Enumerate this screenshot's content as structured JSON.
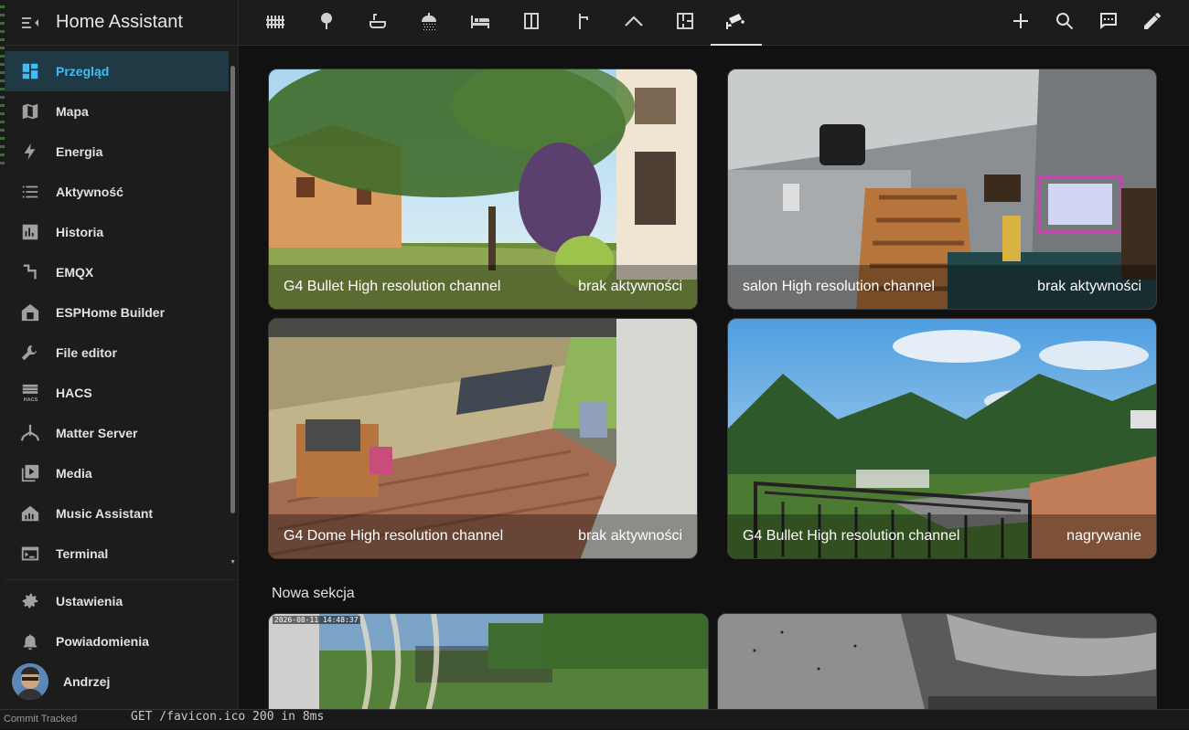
{
  "sidebar": {
    "title": "Home Assistant",
    "items": [
      {
        "label": "Przegląd",
        "icon": "dashboard-icon"
      },
      {
        "label": "Mapa",
        "icon": "map-icon"
      },
      {
        "label": "Energia",
        "icon": "lightning-icon"
      },
      {
        "label": "Aktywność",
        "icon": "list-icon"
      },
      {
        "label": "Historia",
        "icon": "chart-icon"
      },
      {
        "label": "EMQX",
        "icon": "network-icon"
      },
      {
        "label": "ESPHome Builder",
        "icon": "esphome-icon"
      },
      {
        "label": "File editor",
        "icon": "wrench-icon"
      },
      {
        "label": "HACS",
        "icon": "hacs-icon"
      },
      {
        "label": "Matter Server",
        "icon": "matter-icon"
      },
      {
        "label": "Media",
        "icon": "play-icon"
      },
      {
        "label": "Music Assistant",
        "icon": "music-icon"
      },
      {
        "label": "Terminal",
        "icon": "terminal-icon"
      }
    ],
    "bottom": [
      {
        "label": "Ustawienia",
        "icon": "gear-icon"
      },
      {
        "label": "Powiadomienia",
        "icon": "bell-icon"
      },
      {
        "label": "Andrzej",
        "icon": "avatar"
      }
    ]
  },
  "topbar": {
    "tabs": [
      "fence-icon",
      "tree-icon",
      "bathtub-icon",
      "shower-icon",
      "bed-icon",
      "door-icon",
      "faucet-icon",
      "roof-icon",
      "floorplan-icon",
      "cctv-icon"
    ],
    "actions": [
      "plus-icon",
      "search-icon",
      "comment-icon",
      "pencil-icon"
    ]
  },
  "cameras": [
    {
      "name": "G4 Bullet High resolution channel",
      "status": "brak aktywności"
    },
    {
      "name": "salon High resolution channel",
      "status": "brak aktywności"
    },
    {
      "name": "G4 Dome High resolution channel",
      "status": "brak aktywności"
    },
    {
      "name": "G4 Bullet High resolution channel",
      "status": "nagrywanie"
    }
  ],
  "section2": {
    "title": "Nowa sekcja",
    "timestamp": "2026-08-11 14:48:37"
  },
  "taskbar": {
    "left": "Commit Tracked",
    "terminal": "GET /favicon.ico 200 in 8ms"
  },
  "colors": {
    "accent": "#41bdf5",
    "active_bg": "#1f3a45",
    "background": "#111111",
    "sidebar": "#1c1c1c"
  }
}
